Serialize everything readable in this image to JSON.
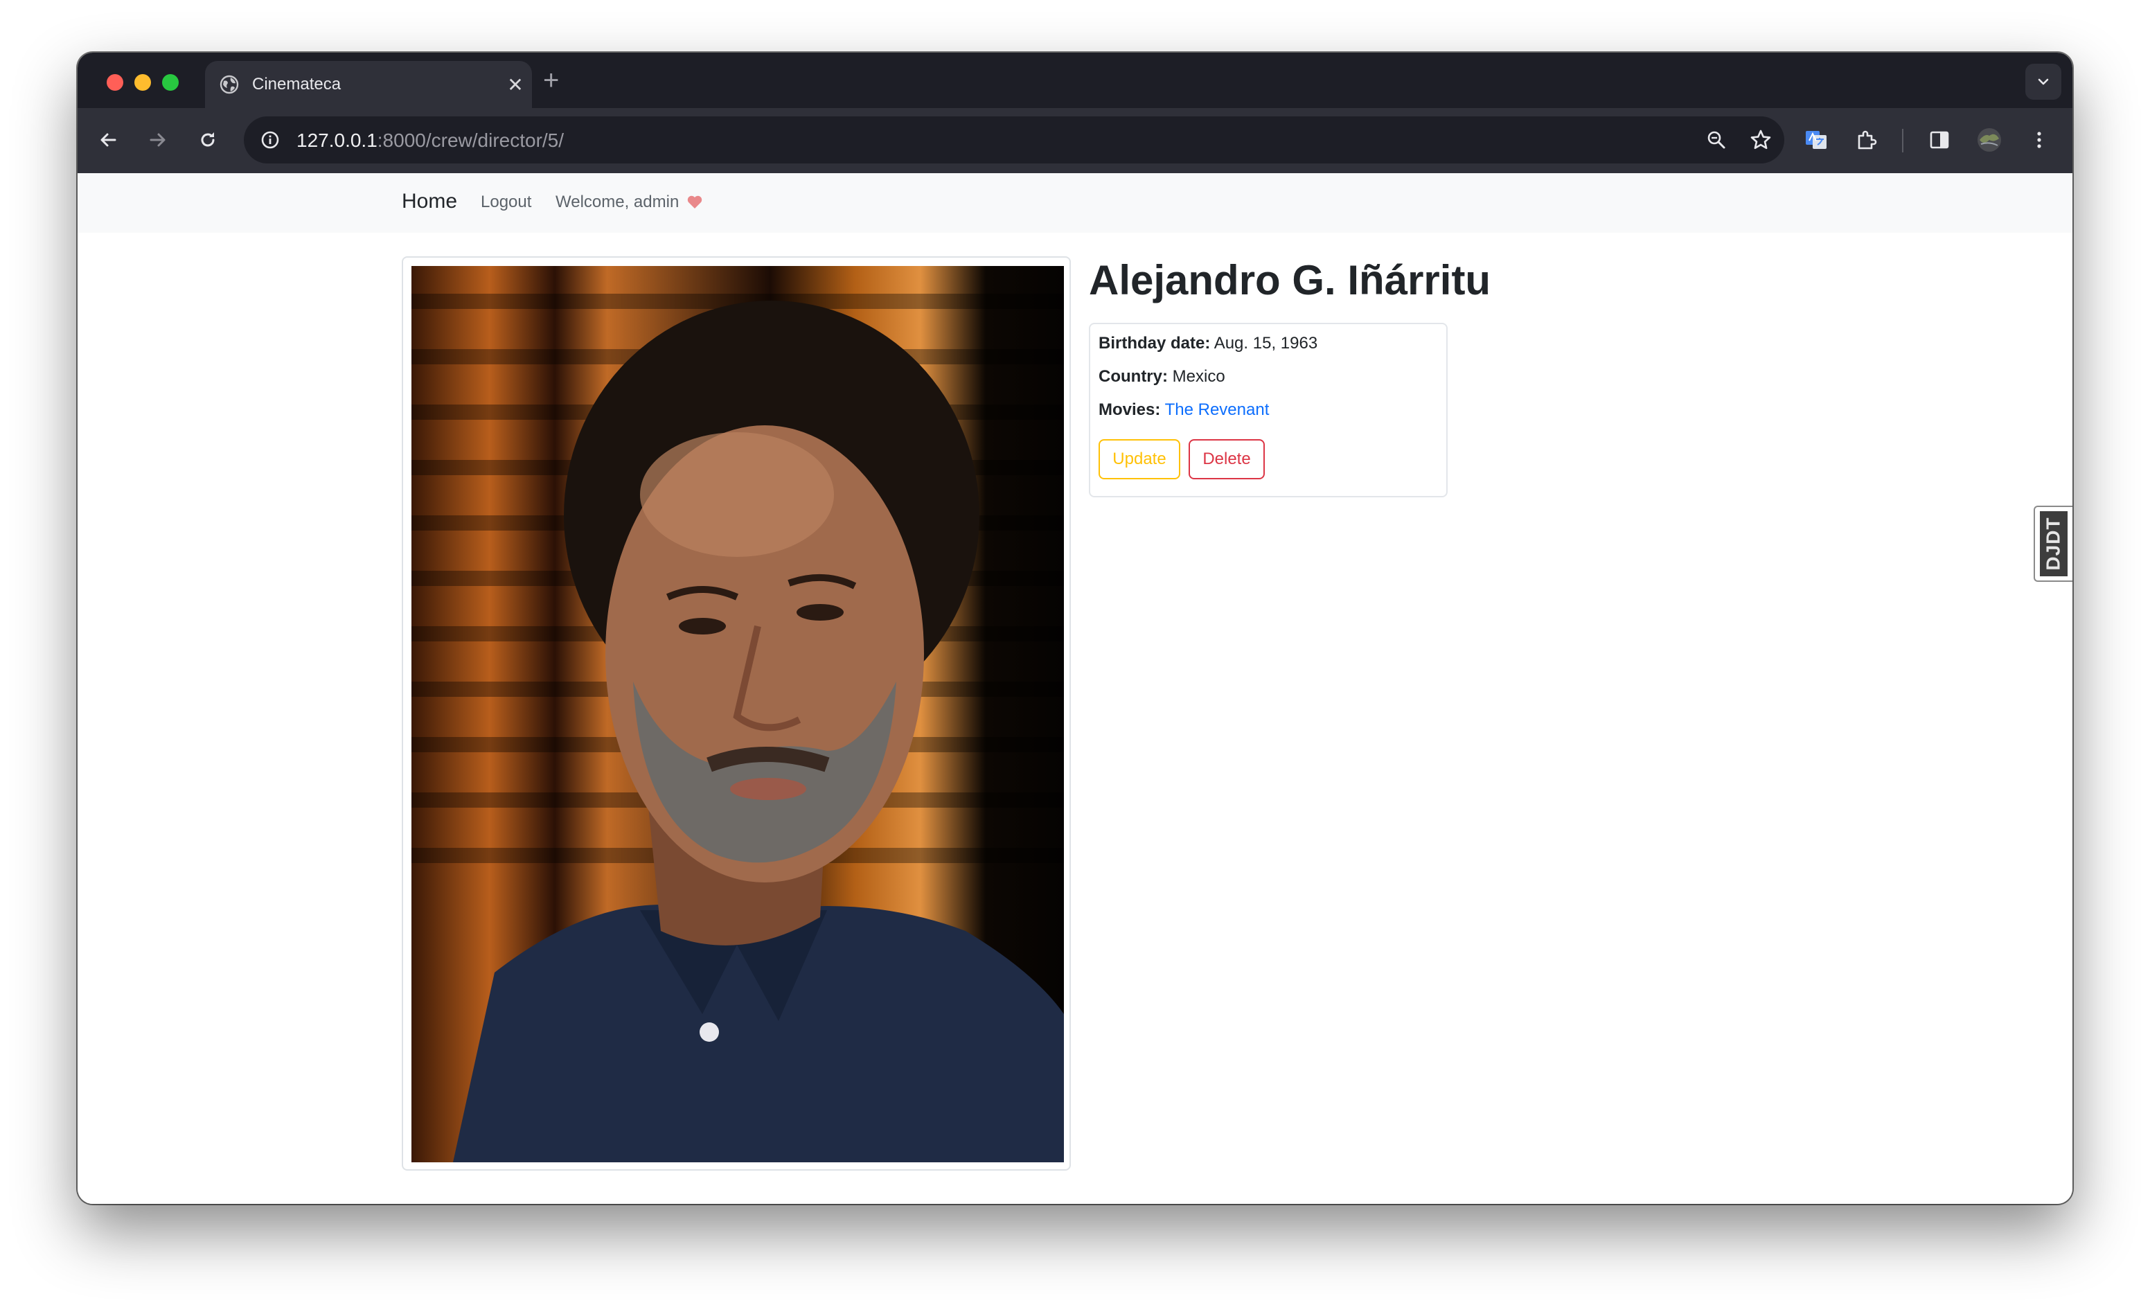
{
  "browser": {
    "tab_title": "Cinemateca",
    "new_tab_symbol": "+",
    "close_symbol": "✕",
    "url_host": "127.0.0.1",
    "url_rest": ":8000/crew/director/5/"
  },
  "navbar": {
    "brand": "Home",
    "logout": "Logout",
    "welcome": "Welcome, admin"
  },
  "director": {
    "name": "Alejandro G. Iñárritu",
    "birthday_label": "Birthday date:",
    "birthday_value": "Aug. 15, 1963",
    "country_label": "Country:",
    "country_value": "Mexico",
    "movies_label": "Movies:",
    "movies": [
      "The Revenant"
    ]
  },
  "actions": {
    "update": "Update",
    "delete": "Delete"
  },
  "debug_toolbar": {
    "label": "DJDT"
  },
  "colors": {
    "update_accent": "#ffc107",
    "delete_accent": "#dc3545",
    "link": "#0d6efd",
    "heart": "#e9888a"
  }
}
